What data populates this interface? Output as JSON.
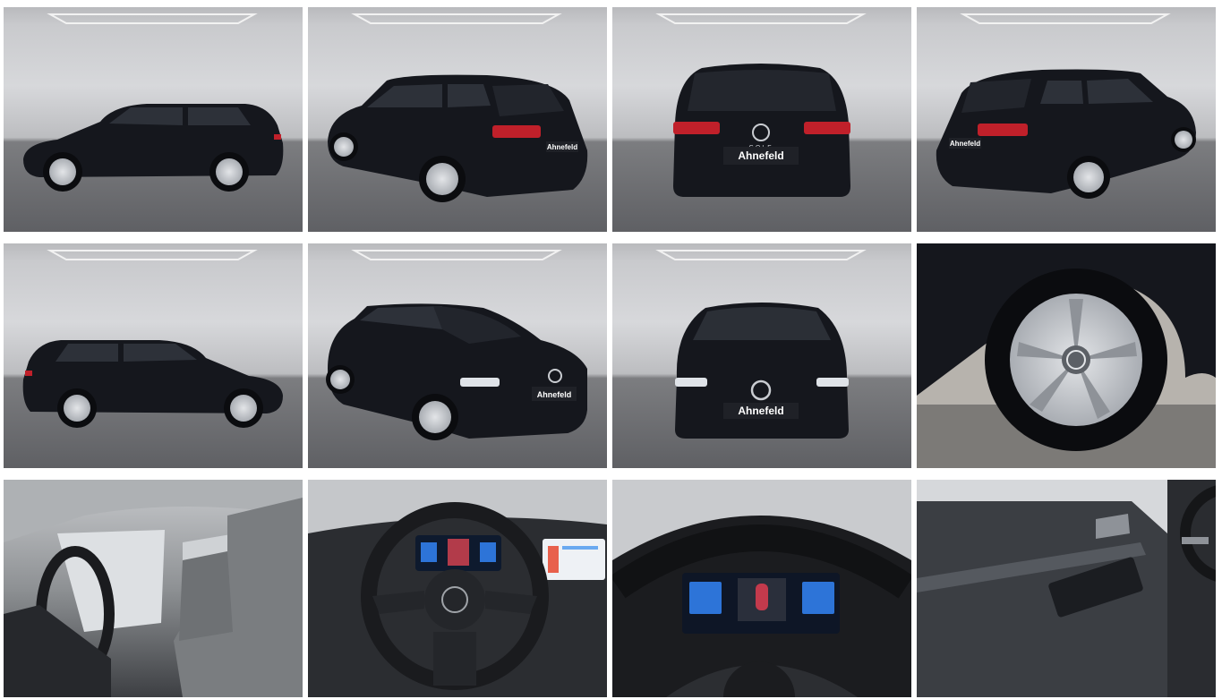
{
  "gallery": {
    "dealer_plate": "Ahnefeld",
    "model_badge": "GOLF",
    "colors": {
      "car_body": "#15171d",
      "taillight": "#c0202a",
      "wheel_rim": "#c9ccd1",
      "studio_wall": "#d4d5d8",
      "studio_floor": "#6e6f73",
      "interior_seat": "#7a7d80",
      "display_blue": "#2d74d8"
    },
    "tiles": [
      {
        "name": "photo-side-left"
      },
      {
        "name": "photo-rear-three-quarter-left"
      },
      {
        "name": "photo-rear"
      },
      {
        "name": "photo-rear-three-quarter-right"
      },
      {
        "name": "photo-side-right"
      },
      {
        "name": "photo-front-three-quarter-left"
      },
      {
        "name": "photo-front"
      },
      {
        "name": "photo-wheel"
      },
      {
        "name": "photo-interior-front-seats"
      },
      {
        "name": "photo-steering-wheel-dashboard"
      },
      {
        "name": "photo-digital-cockpit"
      },
      {
        "name": "photo-door-panel"
      }
    ]
  }
}
